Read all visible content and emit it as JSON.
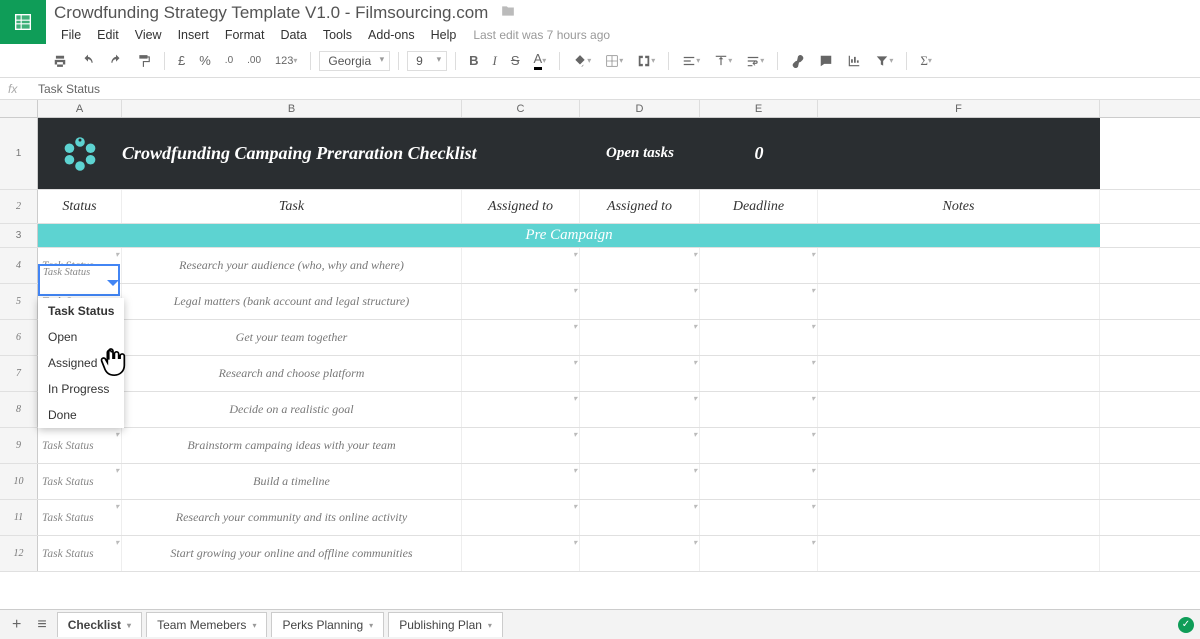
{
  "doc": {
    "title": "Crowdfunding Strategy Template V1.0 - Filmsourcing.com"
  },
  "menus": {
    "file": "File",
    "edit": "Edit",
    "view": "View",
    "insert": "Insert",
    "format": "Format",
    "data": "Data",
    "tools": "Tools",
    "addons": "Add-ons",
    "help": "Help",
    "last_edit": "Last edit was 7 hours ago"
  },
  "toolbar": {
    "currency": "£",
    "percent": "%",
    "dec1": ".0",
    "dec2": ".00",
    "num": "123",
    "font": "Georgia",
    "size": "9",
    "bold": "B",
    "italic": "I",
    "strike": "S",
    "sum": "Σ"
  },
  "fx": {
    "label": "fx",
    "value": "Task Status"
  },
  "cols": {
    "A": "A",
    "B": "B",
    "C": "C",
    "D": "D",
    "E": "E",
    "F": "F"
  },
  "banner": {
    "title": "Crowdfunding Campaing Preraration Checklist",
    "open_label": "Open tasks",
    "open_count": "0"
  },
  "headers": {
    "status": "Status",
    "task": "Task",
    "assigned1": "Assigned to",
    "assigned2": "Assigned to",
    "deadline": "Deadline",
    "notes": "Notes"
  },
  "section": {
    "pre": "Pre Campaign"
  },
  "rows": [
    {
      "n": "4",
      "status": "Task Status",
      "task": "Research your audience (who, why and where)"
    },
    {
      "n": "5",
      "status": "Task Status",
      "task": "Legal matters (bank account and legal structure)"
    },
    {
      "n": "6",
      "status": "",
      "task": "Get your team together"
    },
    {
      "n": "7",
      "status": "",
      "task": "Research and choose platform"
    },
    {
      "n": "8",
      "status": "",
      "task": "Decide on a realistic goal"
    },
    {
      "n": "9",
      "status": "Task Status",
      "task": "Brainstorm campaing ideas with your team"
    },
    {
      "n": "10",
      "status": "Task Status",
      "task": "Build a timeline"
    },
    {
      "n": "11",
      "status": "Task Status",
      "task": "Research your community and its online activity"
    },
    {
      "n": "12",
      "status": "Task Status",
      "task": "Start growing your online and offline communities"
    }
  ],
  "active_cell_value": "Task Status",
  "dropdown": {
    "opt0": "Task Status",
    "opt1": "Open",
    "opt2": "Assigned",
    "opt3": "In Progress",
    "opt4": "Done"
  },
  "tabs": {
    "t1": "Checklist",
    "t2": "Team Memebers",
    "t3": "Perks Planning",
    "t4": "Publishing Plan"
  }
}
